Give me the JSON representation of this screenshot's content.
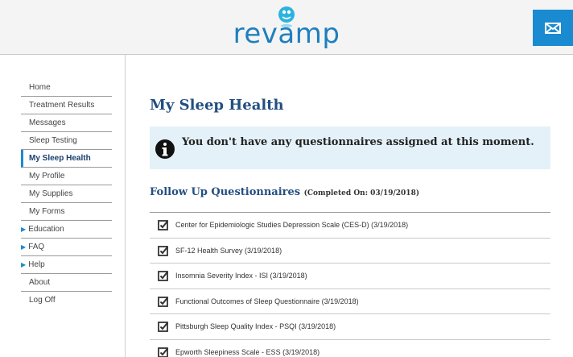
{
  "header": {
    "logo_text": "revamp",
    "mail_icon": "envelope-icon",
    "colors": {
      "brand": "#1a8bd0",
      "header_bg": "#f4f4f4"
    }
  },
  "sidebar": {
    "items": [
      {
        "label": "Home"
      },
      {
        "label": "Treatment Results"
      },
      {
        "label": "Messages"
      },
      {
        "label": "Sleep Testing"
      },
      {
        "label": "My Sleep Health",
        "active": true
      },
      {
        "label": "My Profile"
      },
      {
        "label": "My Supplies"
      },
      {
        "label": "My Forms"
      },
      {
        "label": "Education",
        "expandable": true
      },
      {
        "label": "FAQ",
        "expandable": true
      },
      {
        "label": "Help",
        "expandable": true
      },
      {
        "label": "About"
      },
      {
        "label": "Log Off"
      }
    ]
  },
  "main": {
    "title": "My Sleep Health",
    "alert": {
      "icon": "info-icon",
      "text": "You don't have any questionnaires assigned at this moment."
    },
    "section": {
      "title": "Follow Up Questionnaires",
      "note": "(Completed On: 03/19/2018)"
    },
    "questionnaires": [
      {
        "label": "Center for Epidemiologic Studies Depression Scale (CES-D) (3/19/2018)"
      },
      {
        "label": "SF-12 Health Survey (3/19/2018)"
      },
      {
        "label": "Insomnia Severity Index - ISI (3/19/2018)"
      },
      {
        "label": "Functional Outcomes of Sleep Questionnaire (3/19/2018)"
      },
      {
        "label": "Pittsburgh Sleep Quality Index - PSQI (3/19/2018)"
      },
      {
        "label": "Epworth Sleepiness Scale - ESS (3/19/2018)"
      }
    ]
  }
}
